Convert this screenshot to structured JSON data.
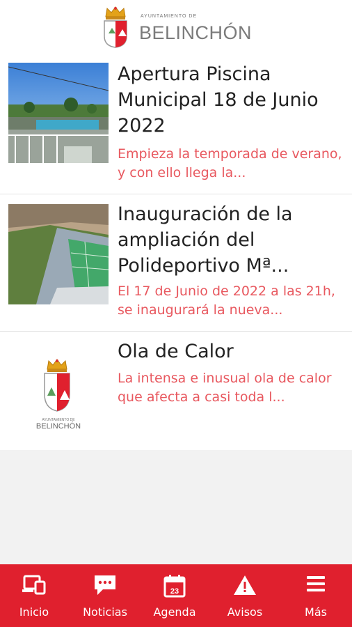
{
  "header": {
    "brand_small": "AYUNTAMIENTO DE",
    "brand_name": "BELINCHÓN"
  },
  "news": [
    {
      "title": "Apertura Piscina Municipal 18 de Junio 2022",
      "snippet": "Empieza la temporada de verano, y con ello llega la...",
      "thumbnail": "pool-photo"
    },
    {
      "title": "Inauguración de la ampliación del Polideportivo Mª...",
      "snippet": "El 17 de Junio de 2022 a las 21h, se inaugurará la nueva...",
      "thumbnail": "sports-court-photo"
    },
    {
      "title": "Ola de Calor",
      "snippet": "La intensa e inusual ola de calor que afecta a casi toda l...",
      "thumbnail": "town-logo",
      "thumbnail_caption_small": "AYUNTAMIENTO DE",
      "thumbnail_caption": "BELINCHÓN"
    }
  ],
  "tabbar": {
    "tabs": [
      {
        "label": "Inicio",
        "icon": "devices-icon"
      },
      {
        "label": "Noticias",
        "icon": "chat-bubble-icon"
      },
      {
        "label": "Agenda",
        "icon": "calendar-icon",
        "icon_text": "23"
      },
      {
        "label": "Avisos",
        "icon": "warning-icon"
      },
      {
        "label": "Más",
        "icon": "menu-icon"
      }
    ]
  },
  "colors": {
    "accent": "#e0202e",
    "snippet": "#e8585f",
    "title": "#222222"
  }
}
